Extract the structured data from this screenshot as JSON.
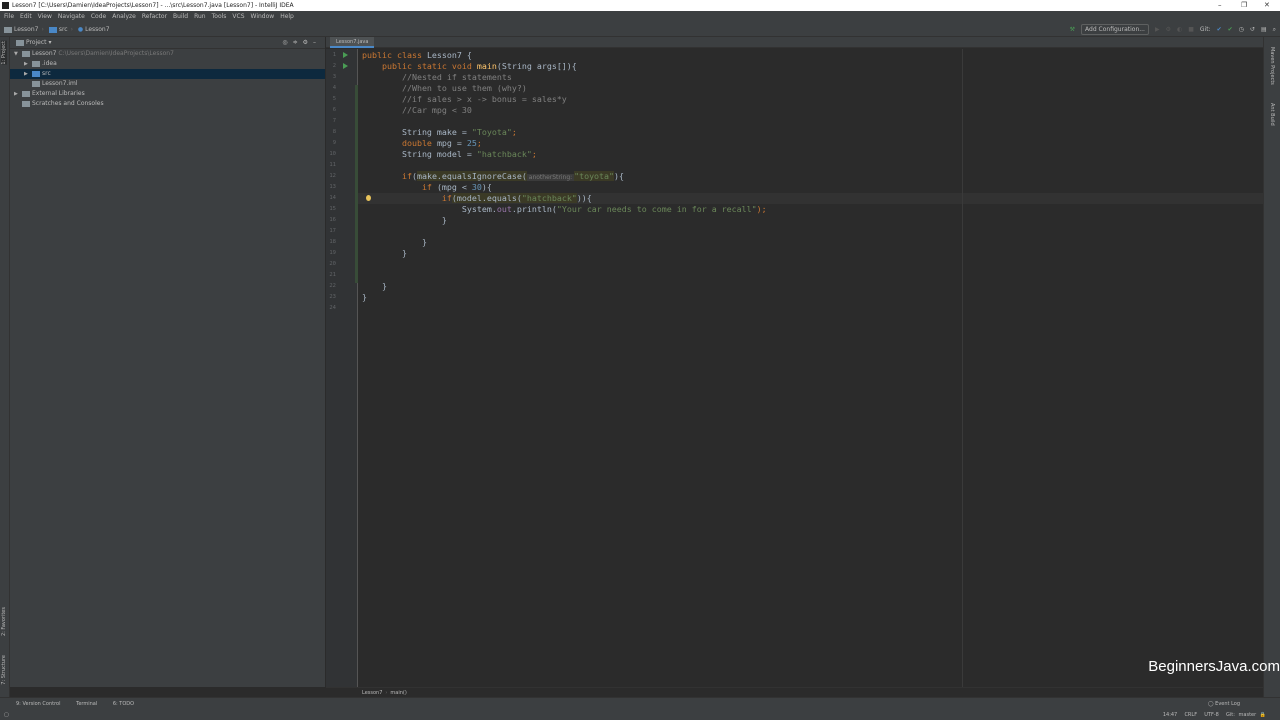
{
  "window": {
    "title": "Lesson7 [C:\\Users\\Damien\\IdeaProjects\\Lesson7] - ...\\src\\Lesson7.java [Lesson7] - IntelliJ IDEA"
  },
  "menu": [
    "File",
    "Edit",
    "View",
    "Navigate",
    "Code",
    "Analyze",
    "Refactor",
    "Build",
    "Run",
    "Tools",
    "VCS",
    "Window",
    "Help"
  ],
  "navbar": {
    "items": [
      "Lesson7",
      "src",
      "Lesson7"
    ]
  },
  "toolbar": {
    "add_config": "Add Configuration...",
    "git_label": "Git:"
  },
  "project": {
    "header": "Project",
    "tree": [
      {
        "label": "Lesson7",
        "path": "C:\\Users\\Damien\\IdeaProjects\\Lesson7",
        "indent": 0,
        "arrow": "▼"
      },
      {
        "label": ".idea",
        "indent": 1,
        "arrow": "▶"
      },
      {
        "label": "src",
        "indent": 1,
        "arrow": "▶",
        "selected": true
      },
      {
        "label": "Lesson7.iml",
        "indent": 1,
        "arrow": ""
      },
      {
        "label": "External Libraries",
        "indent": 0,
        "arrow": "▶"
      },
      {
        "label": "Scratches and Consoles",
        "indent": 0,
        "arrow": ""
      }
    ]
  },
  "left_stripe": {
    "project": "1: Project",
    "favorites": "2: Favorites",
    "structure": "7: Structure"
  },
  "right_stripe": {
    "maven": "Maven Projects",
    "antbuild": "Ant Build"
  },
  "editor": {
    "tab": "Lesson7.java",
    "lines": [
      [
        [
          "public class ",
          "kw"
        ],
        [
          "Lesson7 {",
          "pl"
        ]
      ],
      [
        [
          "    public static void ",
          "kw"
        ],
        [
          "main",
          "fn"
        ],
        [
          "(String args[]){",
          "pl"
        ]
      ],
      [
        [
          "        //Nested if statements",
          "cm"
        ]
      ],
      [
        [
          "        //When to use them (why?)",
          "cm"
        ]
      ],
      [
        [
          "        //if sales > x -> bonus = sales*y",
          "cm"
        ]
      ],
      [
        [
          "        //Car mpg < 30",
          "cm"
        ]
      ],
      [],
      [
        [
          "        String make = ",
          "pl"
        ],
        [
          "\"Toyota\"",
          "str"
        ],
        [
          ";",
          "kw"
        ]
      ],
      [
        [
          "        double ",
          "kw"
        ],
        [
          "mpg = ",
          "pl"
        ],
        [
          "25",
          "num"
        ],
        [
          ";",
          "kw"
        ]
      ],
      [
        [
          "        String model = ",
          "pl"
        ],
        [
          "\"hatchback\"",
          "str"
        ],
        [
          ";",
          "kw"
        ]
      ],
      [],
      [
        [
          "        if",
          "kw"
        ],
        [
          "(",
          "pl"
        ],
        [
          "make.equalsIgnoreCase(",
          "pl hl"
        ],
        [
          " anotherString: ",
          "hint"
        ],
        [
          "\"toyota\"",
          "str hl"
        ],
        [
          "){",
          "pl"
        ]
      ],
      [
        [
          "            if ",
          "kw"
        ],
        [
          "(mpg < ",
          "pl"
        ],
        [
          "30",
          "num"
        ],
        [
          "){",
          "pl"
        ]
      ],
      [
        [
          "                if",
          "kw"
        ],
        [
          "(model.equals(",
          "pl hl"
        ],
        [
          "\"hatchback\"",
          "str hl"
        ],
        [
          ")){",
          "pl"
        ]
      ],
      [
        [
          "                    System.",
          "pl"
        ],
        [
          "out",
          "fld"
        ],
        [
          ".println(",
          "pl"
        ],
        [
          "\"Your car needs to come in for a recall\"",
          "str"
        ],
        [
          ");",
          "kw"
        ]
      ],
      [
        [
          "                }",
          "pl"
        ]
      ],
      [],
      [
        [
          "            }",
          "pl"
        ]
      ],
      [
        [
          "        }",
          "pl"
        ]
      ],
      [],
      [],
      [
        [
          "    }",
          "pl"
        ]
      ],
      [
        [
          "}",
          "pl"
        ]
      ],
      []
    ]
  },
  "breadcrumb": [
    "Lesson7",
    "main()"
  ],
  "bottom_tools": [
    "9: Version Control",
    "Terminal",
    "6: TODO"
  ],
  "status": {
    "event_log": "Event Log",
    "position": "14:47",
    "line_sep": "CRLF",
    "encoding": "UTF-8",
    "vcs": "Git: master"
  },
  "watermark": "BeginnersJava.com"
}
